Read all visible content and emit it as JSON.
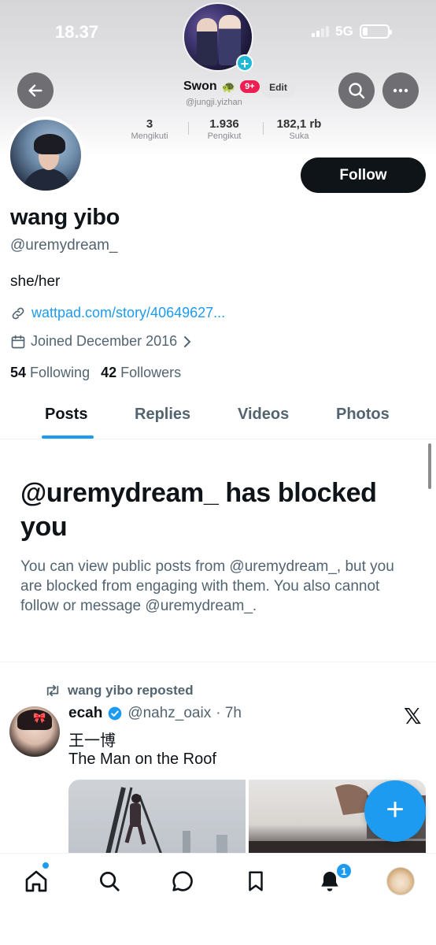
{
  "status_bar": {
    "time": "18.37",
    "network": "5G"
  },
  "tiktok_header": {
    "name": "Swon",
    "badge": "9+",
    "edit_label": "Edit",
    "handle": "@jungji.yizhan",
    "stats": [
      {
        "value": "3",
        "label": "Mengikuti"
      },
      {
        "value": "1.936",
        "label": "Pengikut"
      },
      {
        "value": "182,1 rb",
        "label": "Suka"
      }
    ]
  },
  "profile": {
    "follow_label": "Follow",
    "display_name": "wang yibo",
    "username": "@uremydream_",
    "bio": "she/her",
    "link": "wattpad.com/story/40649627...",
    "joined": "Joined December 2016",
    "following_count": "54",
    "following_label": "Following",
    "followers_count": "42",
    "followers_label": "Followers"
  },
  "tabs": [
    "Posts",
    "Replies",
    "Videos",
    "Photos"
  ],
  "blocked": {
    "title": "@uremydream_ has blocked you",
    "message": "You can view public posts from @uremydream_, but you are blocked from engaging with them. You also cannot follow or message @uremydream_."
  },
  "post": {
    "repost_label": "wang yibo reposted",
    "author_name": "ecah",
    "author_handle": "@nahz_oaix",
    "time": "· 7h",
    "line1": "王一博",
    "line2": "The Man on the Roof"
  },
  "fab_label": "+",
  "bottom_nav": {
    "notification_count": "1"
  },
  "colors": {
    "accent": "#1d9bf0",
    "text": "#0f1419",
    "muted": "#536471",
    "tiktok_badge": "#ee1d52"
  }
}
